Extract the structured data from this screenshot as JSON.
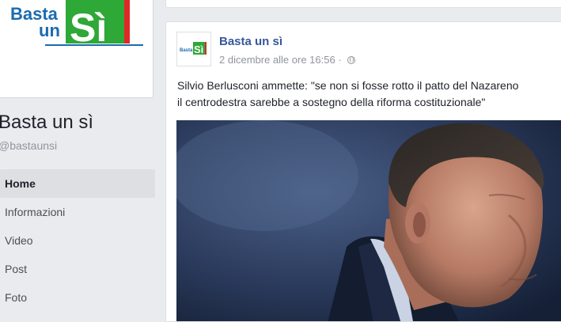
{
  "page": {
    "logo_text_left_1": "Basta",
    "logo_text_left_2": "un",
    "logo_text_big": "Sì",
    "name": "Basta un sì",
    "handle": "@bastaunsi"
  },
  "nav": {
    "items": [
      {
        "label": "Home",
        "active": true
      },
      {
        "label": "Informazioni",
        "active": false
      },
      {
        "label": "Video",
        "active": false
      },
      {
        "label": "Post",
        "active": false
      },
      {
        "label": "Foto",
        "active": false
      }
    ]
  },
  "post": {
    "author": "Basta un sì",
    "date": "2 dicembre alle ore 16:56",
    "separator": "·",
    "privacy_icon": "globe-icon",
    "text_line_1": "Silvio Berlusconi ammette: \"se non si fosse rotto il patto del Nazareno",
    "text_line_2": "il centrodestra sarebbe a sostegno della riforma costituzionale\""
  },
  "colors": {
    "background": "#e9ebee",
    "link_blue": "#365899",
    "logo_blue": "#1b6bb0",
    "logo_green": "#2ea836",
    "logo_red": "#e02828"
  }
}
